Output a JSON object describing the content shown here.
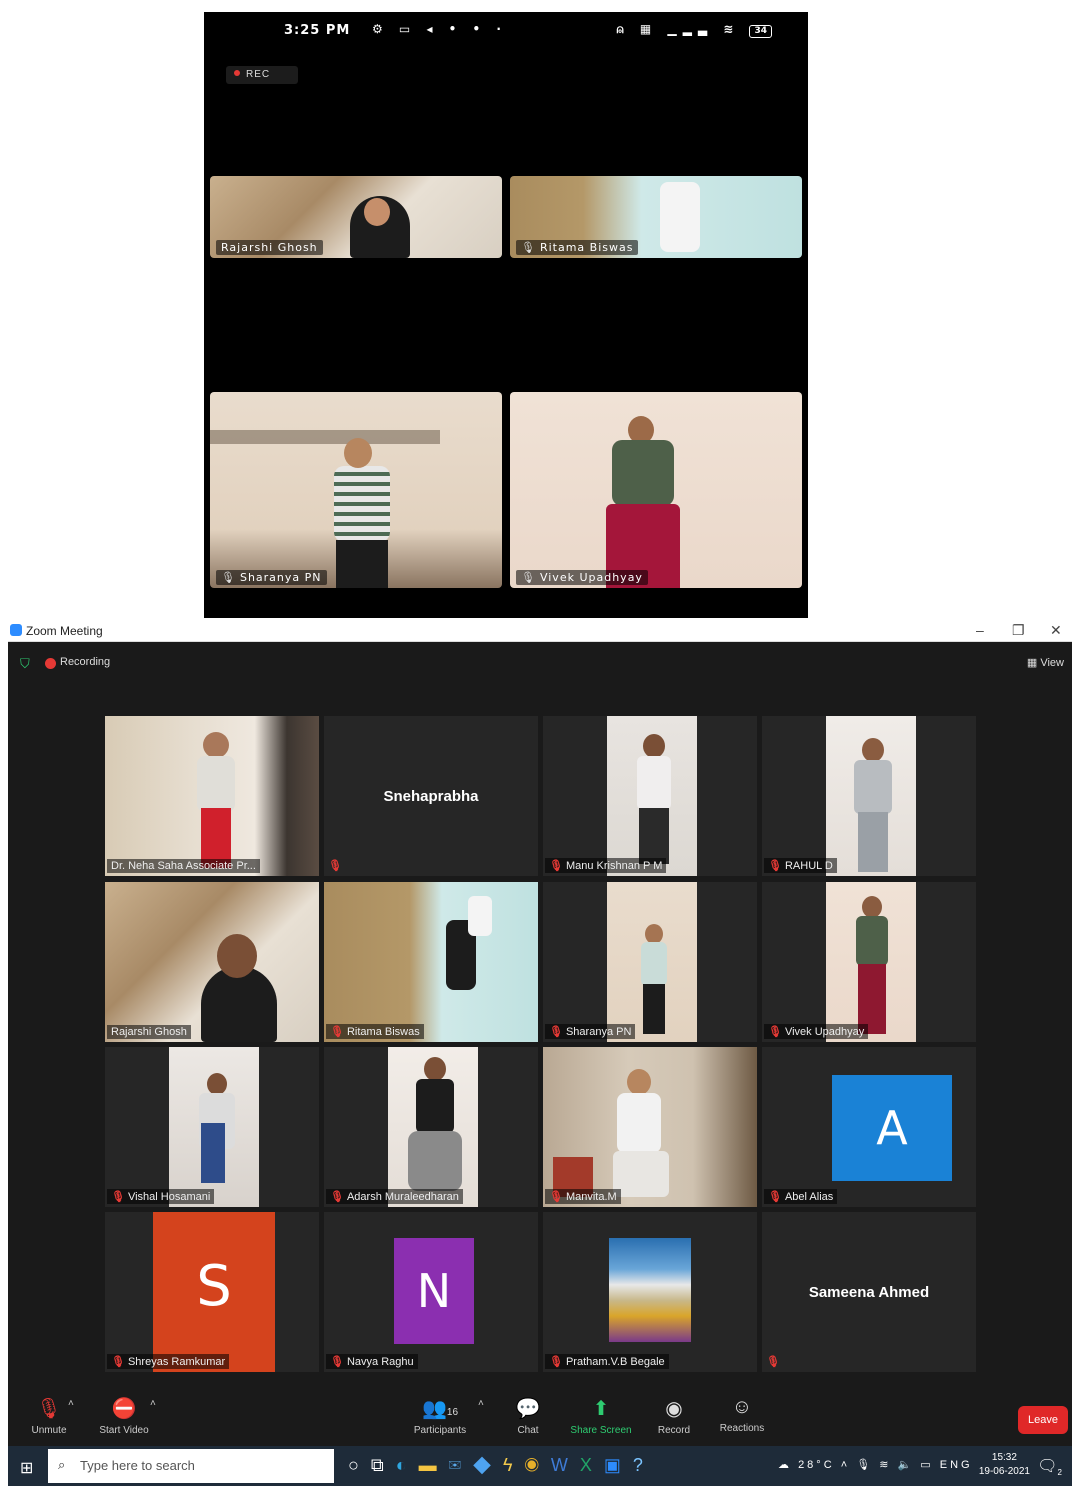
{
  "phone": {
    "time": "3:25 PM",
    "rec_label": "REC",
    "battery": "34",
    "tiles": [
      "Rajarshi Ghosh",
      "Ritama Biswas",
      "Sharanya PN",
      "Vivek Upadhyay"
    ]
  },
  "window": {
    "title": "Zoom Meeting",
    "recording_label": "Recording",
    "view_label": "View"
  },
  "participants": [
    {
      "name": "Dr. Neha Saha Associate Pr...",
      "kind": "video",
      "active": true,
      "muted": false
    },
    {
      "name": "Snehaprabha",
      "kind": "name",
      "muted": true
    },
    {
      "name": "Manu Krishnan P M",
      "kind": "video",
      "muted": true
    },
    {
      "name": "RAHUL D",
      "kind": "video",
      "muted": true
    },
    {
      "name": "Rajarshi Ghosh",
      "kind": "video",
      "muted": false
    },
    {
      "name": "Ritama Biswas",
      "kind": "video",
      "muted": true
    },
    {
      "name": "Sharanya PN",
      "kind": "video",
      "muted": true
    },
    {
      "name": "Vivek Upadhyay",
      "kind": "video",
      "muted": true
    },
    {
      "name": "Vishal Hosamani",
      "kind": "video",
      "muted": true
    },
    {
      "name": "Adarsh Muraleedharan",
      "kind": "video",
      "muted": true
    },
    {
      "name": "Manvita.M",
      "kind": "video",
      "muted": true
    },
    {
      "name": "Abel Alias",
      "kind": "avatar",
      "letter": "A",
      "color": "#1a82d6",
      "muted": true
    },
    {
      "name": "Shreyas Ramkumar",
      "kind": "avatar",
      "letter": "S",
      "color": "#d4431d",
      "muted": true
    },
    {
      "name": "Navya Raghu",
      "kind": "avatar",
      "letter": "N",
      "color": "#8b2fb0",
      "muted": true
    },
    {
      "name": "Pratham.V.B Begale",
      "kind": "image",
      "muted": true
    },
    {
      "name": "Sameena Ahmed",
      "kind": "name",
      "muted": true
    }
  ],
  "toolbar": {
    "unmute": "Unmute",
    "start_video": "Start Video",
    "participants": "Participants",
    "participants_count": "16",
    "chat": "Chat",
    "share_screen": "Share Screen",
    "record": "Record",
    "reactions": "Reactions",
    "leave": "Leave"
  },
  "taskbar": {
    "search_placeholder": "Type here to search",
    "weather": "28°C",
    "language": "ENG",
    "time": "15:32",
    "date": "19-06-2021",
    "notifications": "2"
  }
}
